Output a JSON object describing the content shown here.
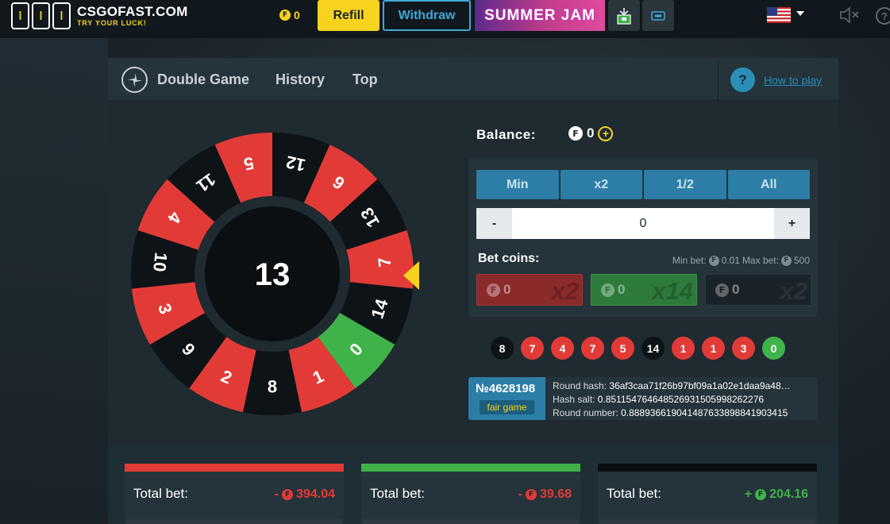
{
  "header": {
    "logo_text": "CSGOFAST.COM",
    "logo_tagline": "TRY YOUR LUCK!",
    "balance": "0",
    "refill_label": "Refill",
    "withdraw_label": "Withdraw",
    "promo_label": "SUMMER JAM",
    "language_flag": "us-flag-icon"
  },
  "nav": {
    "game_title": "Double Game",
    "history_label": "History",
    "top_label": "Top",
    "help_symbol": "?",
    "how_to_play": "How to play"
  },
  "wheel": {
    "center_value": "13",
    "segments": [
      {
        "n": "5",
        "color": "red"
      },
      {
        "n": "12",
        "color": "black"
      },
      {
        "n": "6",
        "color": "red"
      },
      {
        "n": "13",
        "color": "black"
      },
      {
        "n": "7",
        "color": "red"
      },
      {
        "n": "14",
        "color": "black"
      },
      {
        "n": "0",
        "color": "green"
      },
      {
        "n": "1",
        "color": "red"
      },
      {
        "n": "8",
        "color": "black"
      },
      {
        "n": "2",
        "color": "red"
      },
      {
        "n": "9",
        "color": "black"
      },
      {
        "n": "3",
        "color": "red"
      },
      {
        "n": "10",
        "color": "black"
      },
      {
        "n": "4",
        "color": "red"
      },
      {
        "n": "11",
        "color": "black"
      }
    ]
  },
  "bet": {
    "balance_label": "Balance:",
    "balance_value": "0",
    "quick": [
      "Min",
      "x2",
      "1/2",
      "All"
    ],
    "minus": "-",
    "plus": "+",
    "amount": "0",
    "bet_coins_label": "Bet coins:",
    "min_bet_label": "Min bet:",
    "min_bet": "0.01",
    "max_bet_label": "Max bet:",
    "max_bet": "500",
    "tiles": [
      {
        "amount": "0",
        "mult": "x2"
      },
      {
        "amount": "0",
        "mult": "x14"
      },
      {
        "amount": "0",
        "mult": "x2"
      }
    ]
  },
  "history": [
    {
      "n": "8",
      "color": "black"
    },
    {
      "n": "7",
      "color": "red"
    },
    {
      "n": "4",
      "color": "red"
    },
    {
      "n": "7",
      "color": "red"
    },
    {
      "n": "5",
      "color": "red"
    },
    {
      "n": "14",
      "color": "black"
    },
    {
      "n": "1",
      "color": "red"
    },
    {
      "n": "1",
      "color": "red"
    },
    {
      "n": "3",
      "color": "red"
    },
    {
      "n": "0",
      "color": "green"
    }
  ],
  "round": {
    "id": "№4628198",
    "fair_label": "fair game",
    "hash_label": "Round hash:",
    "hash": "36af3caa71f26b97bf09a1a02e1daa9a48…",
    "salt_label": "Hash salt:",
    "salt": "0.851154764648526931505998262276",
    "number_label": "Round number:",
    "number": "0.888936619041487633898841903415"
  },
  "totals": [
    {
      "label": "Total bet:",
      "sign": "-",
      "value": "394.04",
      "color": "#e23b37"
    },
    {
      "label": "Total bet:",
      "sign": "-",
      "value": "39.68",
      "color": "#e23b37"
    },
    {
      "label": "Total bet:",
      "sign": "+",
      "value": "204.16",
      "color": "#3fb34a"
    }
  ],
  "colors": {
    "red": "#e23b37",
    "green": "#3fb34a",
    "black": "#0d1317",
    "accent_blue": "#2c7ea6",
    "yellow": "#f7d31f"
  }
}
